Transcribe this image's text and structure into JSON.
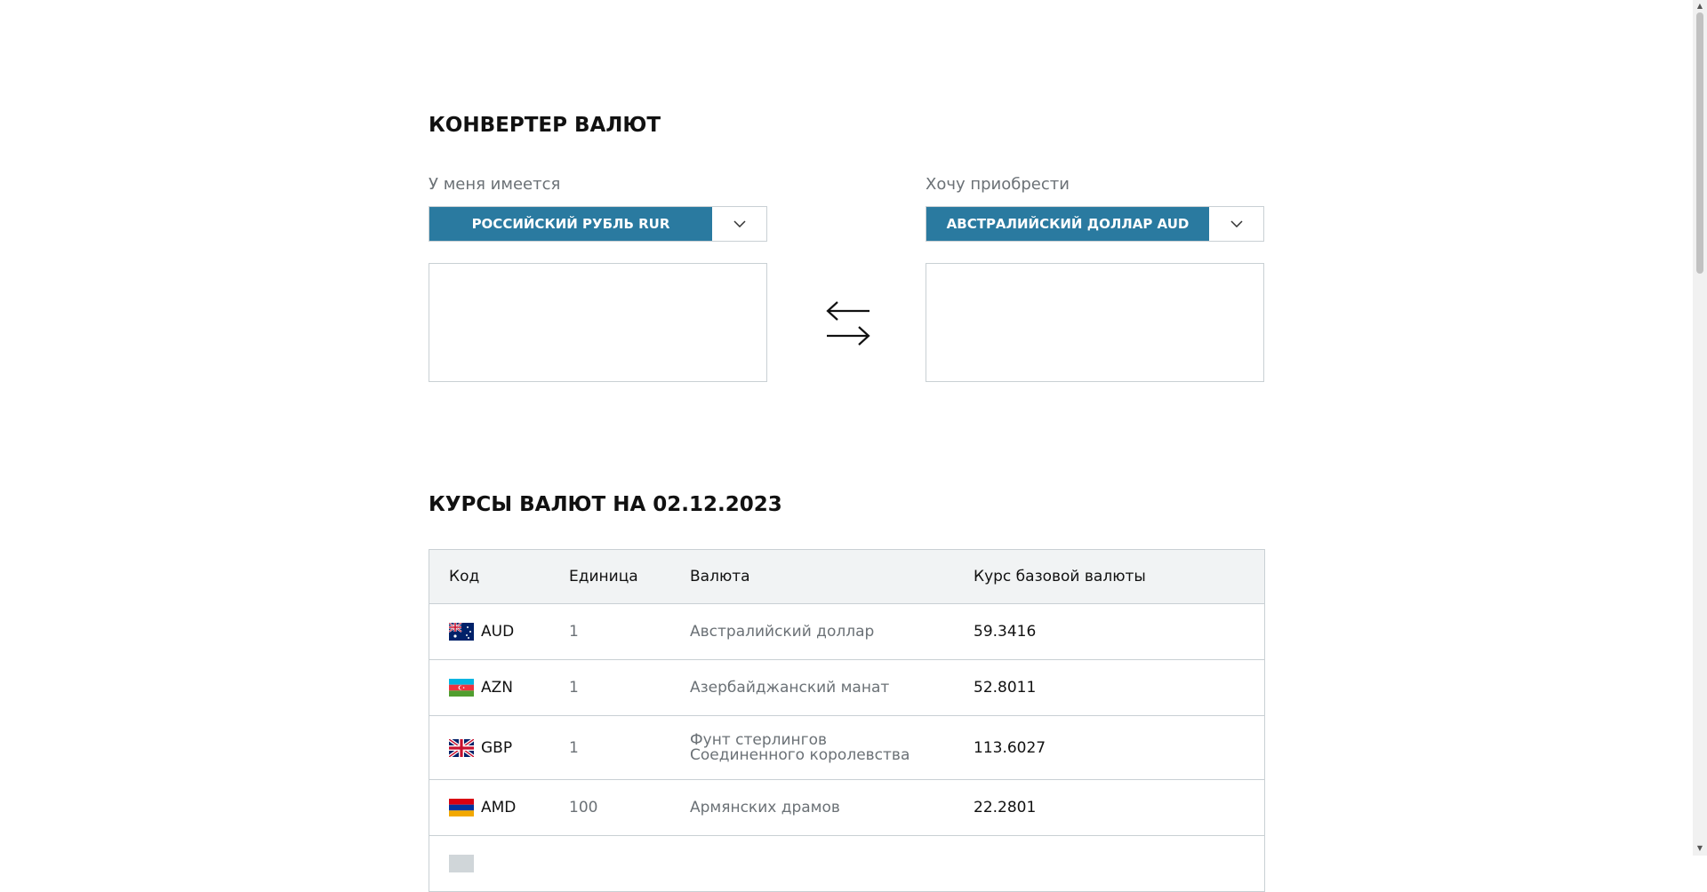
{
  "converter": {
    "title": "КОНВЕРТЕР ВАЛЮТ",
    "have_label": "У меня имеется",
    "have_currency": "РОССИЙСКИЙ РУБЛЬ RUR",
    "have_amount": "",
    "want_label": "Хочу приобрести",
    "want_currency": "АВСТРАЛИЙСКИЙ ДОЛЛАР AUD",
    "want_amount": "",
    "swap_icon": "swap-arrows-icon"
  },
  "rates": {
    "title": "КУРСЫ ВАЛЮТ НА 02.12.2023",
    "columns": [
      "Код",
      "Единица",
      "Валюта",
      "Курс базовой валюты"
    ],
    "rows": [
      {
        "code": "AUD",
        "unit": "1",
        "name": "Австралийский доллар",
        "rate": "59.3416",
        "flag": "australia-flag-icon"
      },
      {
        "code": "AZN",
        "unit": "1",
        "name": "Азербайджанский манат",
        "rate": "52.8011",
        "flag": "azerbaijan-flag-icon"
      },
      {
        "code": "GBP",
        "unit": "1",
        "name": "Фунт стерлингов Соединенного королевства",
        "rate": "113.6027",
        "flag": "uk-flag-icon"
      },
      {
        "code": "AMD",
        "unit": "100",
        "name": "Армянских драмов",
        "rate": "22.2801",
        "flag": "armenia-flag-icon"
      }
    ]
  },
  "colors": {
    "accent": "#2a7aa0",
    "border": "#c9d0d4",
    "header_bg": "#f1f3f4",
    "muted_text": "#6b7176"
  }
}
